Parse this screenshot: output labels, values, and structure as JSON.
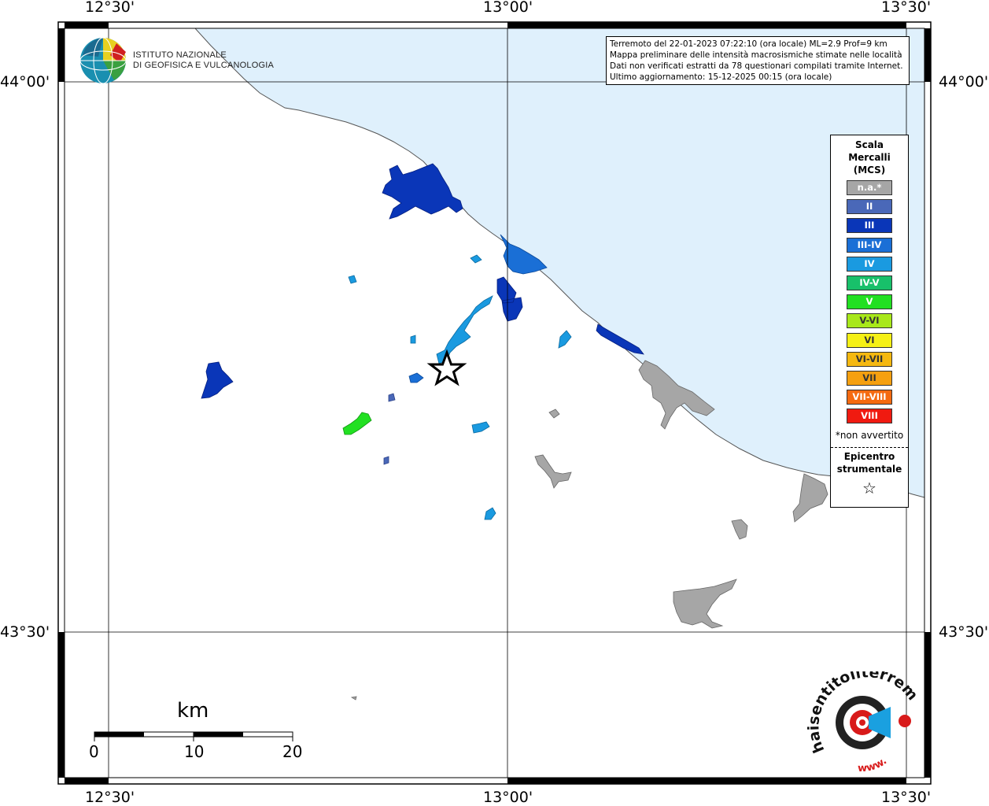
{
  "coordinates": {
    "top": [
      "12°30'",
      "13°00'",
      "13°30'"
    ],
    "bottom": [
      "12°30'",
      "13°00'",
      "13°30'"
    ],
    "left": [
      "44°00'",
      "43°30'"
    ],
    "right": [
      "44°00'",
      "43°30'"
    ]
  },
  "logo_ingv": {
    "line1": "ISTITUTO NAZIONALE",
    "line2": "DI GEOFISICA E VULCANOLOGIA"
  },
  "info": {
    "line1": "Terremoto del 22-01-2023 07:22:10 (ora locale) ML=2.9 Prof=9 km",
    "line2": "Mappa preliminare delle intensità macrosismiche stimate nelle località",
    "line3": "Dati non verificati estratti da 78 questionari compilati tramite Internet.",
    "line4": "Ultimo aggiornamento: 15-12-2025 00:15 (ora locale)"
  },
  "legend": {
    "title1": "Scala",
    "title2": "Mercalli",
    "title3": "(MCS)",
    "items": [
      {
        "label": "n.a.*",
        "color": "#a6a6a6"
      },
      {
        "label": "II",
        "color": "#4a68b8"
      },
      {
        "label": "III",
        "color": "#0a36b8"
      },
      {
        "label": "III-IV",
        "color": "#1a6fd6"
      },
      {
        "label": "IV",
        "color": "#1a9ae0"
      },
      {
        "label": "IV-V",
        "color": "#18c06a"
      },
      {
        "label": "V",
        "color": "#22e022"
      },
      {
        "label": "V-VI",
        "color": "#a8e81a"
      },
      {
        "label": "VI",
        "color": "#f5f015"
      },
      {
        "label": "VI-VII",
        "color": "#f5b810"
      },
      {
        "label": "VII",
        "color": "#f5a010"
      },
      {
        "label": "VII-VIII",
        "color": "#f56a10"
      },
      {
        "label": "VIII",
        "color": "#f01a10"
      }
    ],
    "note": "*non avvertito",
    "epi1": "Epicentro",
    "epi2": "strumentale",
    "star": "☆"
  },
  "scale_bar": {
    "unit": "km",
    "ticks": [
      "0",
      "10",
      "20"
    ]
  },
  "logo_hs": {
    "text": "haisentitoilterremoto.it",
    "url": "www."
  },
  "colors": {
    "sea": "#dff0fc",
    "land": "#ffffff",
    "frame": "#000000"
  }
}
